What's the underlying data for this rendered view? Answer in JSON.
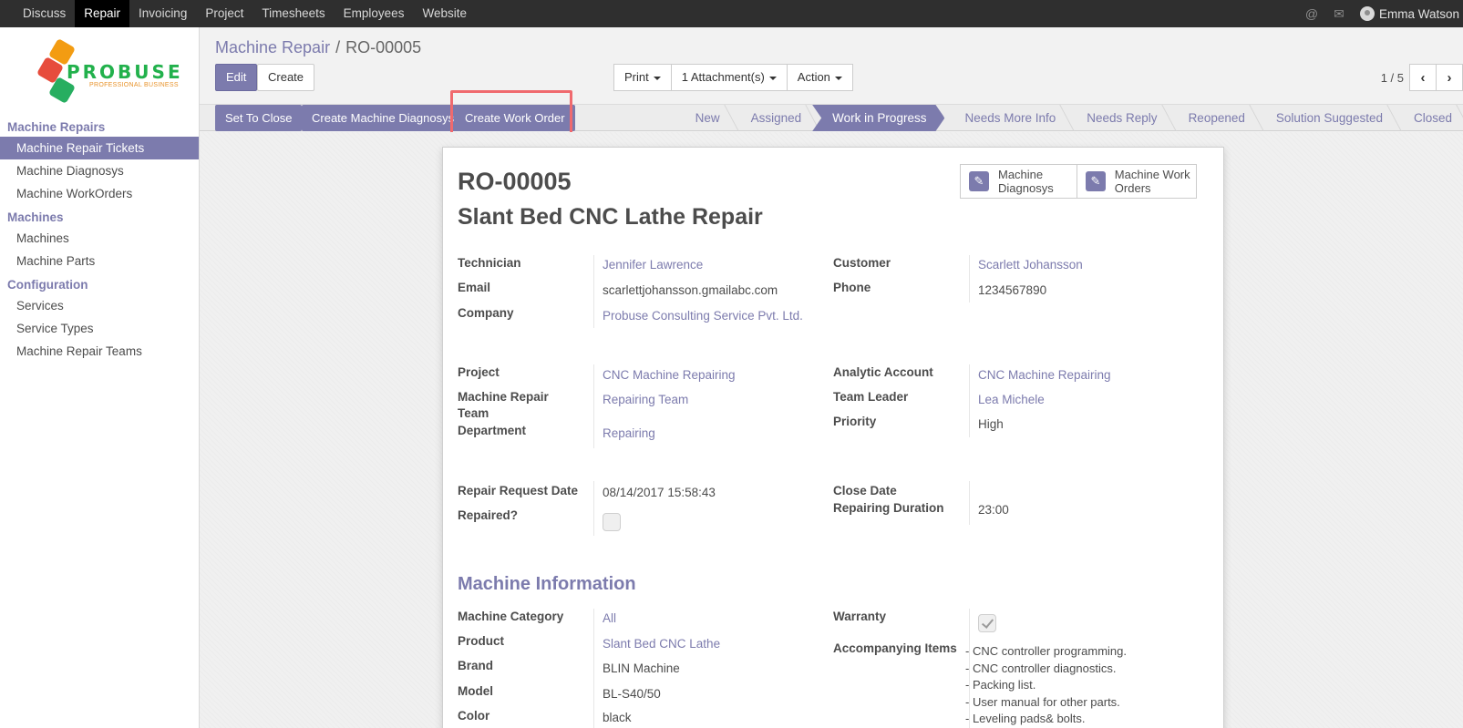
{
  "topbar": {
    "menu": [
      "Discuss",
      "Repair",
      "Invoicing",
      "Project",
      "Timesheets",
      "Employees",
      "Website"
    ],
    "active_index": 1,
    "user_name": "Emma Watson"
  },
  "sidebar": {
    "logo": {
      "text": "PROBUSE",
      "subtitle": "PROFESSIONAL BUSINESS"
    },
    "sections": [
      {
        "title": "Machine Repairs",
        "items": [
          "Machine Repair Tickets",
          "Machine Diagnosys",
          "Machine WorkOrders"
        ]
      },
      {
        "title": "Machines",
        "items": [
          "Machines",
          "Machine Parts"
        ]
      },
      {
        "title": "Configuration",
        "items": [
          "Services",
          "Service Types",
          "Machine Repair Teams"
        ]
      }
    ]
  },
  "breadcrumb": {
    "parent": "Machine Repair",
    "current": "RO-00005"
  },
  "toolbar": {
    "edit": "Edit",
    "create": "Create",
    "print": "Print",
    "attachments": "1 Attachment(s)",
    "action": "Action",
    "pager": "1 / 5"
  },
  "status": {
    "set_to_close": "Set To Close",
    "create_diagnosys": "Create Machine Diagnosys",
    "create_work_order": "Create Work Order",
    "stages": [
      "New",
      "Assigned",
      "Work in Progress",
      "Needs More Info",
      "Needs Reply",
      "Reopened",
      "Solution Suggested",
      "Closed"
    ],
    "active_stage": 2
  },
  "record": {
    "id": "RO-00005",
    "name": "Slant Bed CNC Lathe Repair",
    "smart_diagnosys": "Machine Diagnosys",
    "smart_workorders": "Machine Work Orders",
    "labels": {
      "technician": "Technician",
      "email": "Email",
      "company": "Company",
      "customer": "Customer",
      "phone": "Phone",
      "project": "Project",
      "team": "Machine Repair Team",
      "department": "Department",
      "analytic": "Analytic Account",
      "team_leader": "Team Leader",
      "priority": "Priority",
      "request_date": "Repair Request Date",
      "repaired": "Repaired?",
      "close_date": "Close Date",
      "duration": "Repairing Duration",
      "category": "Machine Category",
      "product": "Product",
      "brand": "Brand",
      "model": "Model",
      "color": "Color",
      "warranty": "Warranty",
      "accompanying": "Accompanying Items"
    },
    "values": {
      "technician": "Jennifer Lawrence",
      "email": "scarlettjohansson.gmailabc.com",
      "company": "Probuse Consulting Service Pvt. Ltd.",
      "customer": "Scarlett Johansson",
      "phone": "1234567890",
      "project": "CNC Machine Repairing",
      "team": "Repairing Team",
      "department": "Repairing",
      "analytic": "CNC Machine Repairing",
      "team_leader": "Lea Michele",
      "priority": "High",
      "request_date": "08/14/2017 15:58:43",
      "duration": "23:00",
      "category": "All",
      "product": "Slant Bed CNC Lathe",
      "brand": "BLIN Machine",
      "model": "BL-S40/50",
      "color": "black",
      "accompanying_items": [
        "- CNC controller programming.",
        "- CNC controller diagnostics.",
        "- Packing list.",
        "- User manual for other parts.",
        "- Leveling pads& bolts."
      ]
    },
    "section_machine_info": "Machine Information"
  }
}
